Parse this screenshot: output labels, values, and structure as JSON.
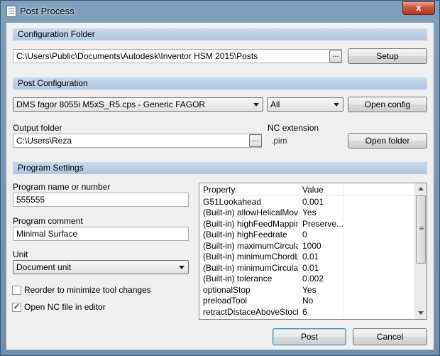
{
  "window": {
    "title": "Post Process",
    "close_glyph": "x",
    "app_icon": "document-icon"
  },
  "config_folder": {
    "header": "Configuration Folder",
    "path": "C:\\Users\\Public\\Documents\\Autodesk\\Inventor HSM 2015\\Posts",
    "browse": "...",
    "setup_button": "Setup"
  },
  "post_config": {
    "header": "Post Configuration",
    "selected_post": "DMS fagor 8055i M5xS_R5.cps - Generic FAGOR",
    "filter": "All",
    "open_config_button": "Open config",
    "output_folder_label": "Output folder",
    "output_folder": "C:\\Users\\Reza",
    "browse": "...",
    "nc_extension_label": "NC extension",
    "nc_extension": ".pim",
    "open_folder_button": "Open folder"
  },
  "program": {
    "header": "Program Settings",
    "name_label": "Program name or number",
    "name_value": "555555",
    "comment_label": "Program comment",
    "comment_value": "Minimal Surface",
    "unit_label": "Unit",
    "unit_value": "Document unit",
    "reorder_label": "Reorder to minimize tool changes",
    "reorder_checked": false,
    "open_nc_label": "Open NC file in editor",
    "open_nc_checked": true,
    "check_glyph": "✓"
  },
  "properties": {
    "col_property": "Property",
    "col_value": "Value",
    "rows": [
      {
        "property": "G51Lookahead",
        "value": "0.001"
      },
      {
        "property": "(Built-in) allowHelicalMoves",
        "value": "Yes"
      },
      {
        "property": "(Built-in) highFeedMapping",
        "value": "Preserve..."
      },
      {
        "property": "(Built-in) highFeedrate",
        "value": "0"
      },
      {
        "property": "(Built-in) maximumCircula...",
        "value": "1000"
      },
      {
        "property": "(Built-in) minimumChordL...",
        "value": "0.01"
      },
      {
        "property": "(Built-in) minimumCircula...",
        "value": "0.01"
      },
      {
        "property": "(Built-in) tolerance",
        "value": "0.002"
      },
      {
        "property": "optionalStop",
        "value": "Yes"
      },
      {
        "property": "preloadTool",
        "value": "No"
      },
      {
        "property": "retractDistaceAboveStock",
        "value": "6"
      }
    ]
  },
  "footer": {
    "post_button": "Post",
    "cancel_button": "Cancel"
  }
}
